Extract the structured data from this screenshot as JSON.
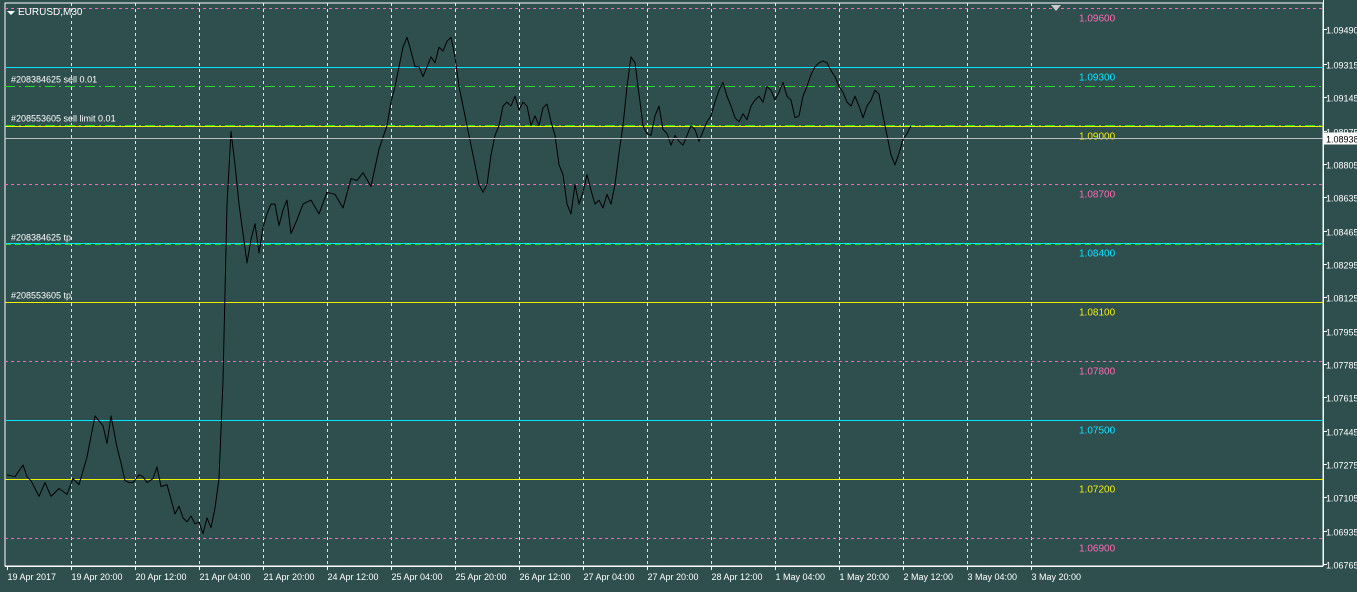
{
  "window": {
    "symbol_label": "EURUSD,M30"
  },
  "colors": {
    "background": "#2f4f4f",
    "frame": "#ffffff",
    "grid": "#ffffff",
    "price_line": "#000000",
    "magenta": "#ff69b4",
    "cyan": "#00e5ff",
    "yellow": "#f0f000",
    "lime": "#22dd22",
    "price_box": "#ffffff"
  },
  "chart_data": {
    "type": "line",
    "symbol": "EURUSD",
    "timeframe": "M30",
    "ylim": [
      1.06755,
      1.09625
    ],
    "y_ticks": [
      "1.09490",
      "1.09315",
      "1.09145",
      "1.08975",
      "1.08805",
      "1.08635",
      "1.08465",
      "1.08295",
      "1.08125",
      "1.07955",
      "1.07785",
      "1.07615",
      "1.07445",
      "1.07275",
      "1.07105",
      "1.06935",
      "1.06765"
    ],
    "y_tick_values": [
      1.0949,
      1.09315,
      1.09145,
      1.08975,
      1.08805,
      1.08635,
      1.08465,
      1.08295,
      1.08125,
      1.07955,
      1.07785,
      1.07615,
      1.07445,
      1.07275,
      1.07105,
      1.06935,
      1.06765
    ],
    "x_ticks": [
      "19 Apr 2017",
      "19 Apr 20:00",
      "20 Apr 12:00",
      "21 Apr 04:00",
      "21 Apr 20:00",
      "24 Apr 12:00",
      "25 Apr 04:00",
      "25 Apr 20:00",
      "26 Apr 12:00",
      "27 Apr 04:00",
      "27 Apr 20:00",
      "28 Apr 12:00",
      "1 May 04:00",
      "1 May 20:00",
      "2 May 12:00",
      "3 May 04:00",
      "3 May 20:00"
    ],
    "x_tick_index": [
      0,
      32,
      64,
      96,
      128,
      160,
      192,
      224,
      256,
      288,
      320,
      352,
      384,
      416,
      448,
      480,
      512
    ],
    "current_price": "1.08938",
    "current_price_value": 1.08938,
    "grid": true,
    "levels": [
      {
        "price": 1.096,
        "label": "1.09600",
        "color": "magenta",
        "style": "dash"
      },
      {
        "price": 1.093,
        "label": "1.09300",
        "color": "cyan",
        "style": "solid"
      },
      {
        "price": 1.09,
        "label": "1.09000",
        "color": "yellow",
        "style": "solid"
      },
      {
        "price": 1.087,
        "label": "1.08700",
        "color": "magenta",
        "style": "dash"
      },
      {
        "price": 1.084,
        "label": "1.08400",
        "color": "cyan",
        "style": "solid"
      },
      {
        "price": 1.081,
        "label": "1.08100",
        "color": "yellow",
        "style": "solid"
      },
      {
        "price": 1.078,
        "label": "1.07800",
        "color": "magenta",
        "style": "dash"
      },
      {
        "price": 1.075,
        "label": "1.07500",
        "color": "cyan",
        "style": "solid"
      },
      {
        "price": 1.072,
        "label": "1.07200",
        "color": "yellow",
        "style": "solid"
      },
      {
        "price": 1.069,
        "label": "1.06900",
        "color": "magenta",
        "style": "dash"
      }
    ],
    "orders": [
      {
        "price": 1.092,
        "label": "#208384625 sell 0.01",
        "color": "lime",
        "style": "dashdot"
      },
      {
        "price": 1.09005,
        "label": "#208553605 sell limit 0.01",
        "color": "lime",
        "style": "dashdot"
      },
      {
        "price": 1.08395,
        "label": "#208384625 tp",
        "color": "lime",
        "style": "dash"
      },
      {
        "price": 1.081,
        "label": "#208553605 tp",
        "color": "",
        "style": ""
      }
    ],
    "series": [
      {
        "x_index": [
          0,
          4,
          8,
          10,
          12,
          16,
          19,
          22,
          26,
          30,
          33,
          36,
          40,
          44,
          48,
          50,
          52,
          55,
          57,
          59,
          61,
          63,
          66,
          68,
          70,
          73,
          75,
          77,
          80,
          84,
          86,
          88,
          90,
          92,
          94,
          96,
          98,
          100,
          102,
          104,
          106,
          108,
          110,
          112,
          114,
          116,
          118,
          120,
          122,
          124,
          126,
          128,
          130,
          132,
          134,
          136,
          138,
          140,
          142,
          145,
          148,
          152,
          156,
          160,
          164,
          168,
          172,
          175,
          178,
          182,
          186,
          190,
          192,
          194,
          196,
          198,
          200,
          202,
          204,
          206,
          208,
          210,
          212,
          214,
          216,
          218,
          220,
          222,
          224,
          226,
          228,
          230,
          232,
          234,
          236,
          238,
          240,
          242,
          244,
          246,
          248,
          250,
          252,
          254,
          256,
          258,
          260,
          262,
          264,
          266,
          268,
          270,
          272,
          274,
          276,
          278,
          280,
          282,
          284,
          286,
          288,
          290,
          292,
          294,
          296,
          298,
          300,
          302,
          304,
          306,
          308,
          310,
          312,
          314,
          316,
          318,
          320,
          322,
          324,
          326,
          328,
          330,
          332,
          334,
          336,
          338,
          340,
          342,
          344,
          346,
          348,
          350,
          352,
          354,
          356,
          358,
          360,
          362,
          364,
          366,
          368,
          370,
          372,
          374,
          376,
          378,
          380,
          382,
          384,
          386,
          388,
          390,
          392,
          394,
          396,
          398,
          400,
          402,
          404,
          406,
          408,
          410,
          412,
          414,
          416,
          418,
          420,
          422,
          424,
          426,
          428,
          430,
          432,
          434,
          436,
          438,
          440,
          442,
          444,
          446,
          448,
          450,
          452,
          454,
          456,
          458,
          460,
          462,
          464,
          466,
          468,
          470,
          472,
          474,
          476,
          478,
          480,
          482,
          484,
          486,
          488,
          490,
          492,
          494,
          496,
          498,
          500,
          502,
          504,
          506,
          508,
          510,
          512,
          514,
          516,
          518,
          520,
          522,
          524
        ],
        "values": [
          1.0722,
          1.0721,
          1.0727,
          1.0721,
          1.0719,
          1.0711,
          1.0718,
          1.0711,
          1.0715,
          1.0712,
          1.072,
          1.0717,
          1.0731,
          1.0752,
          1.0747,
          1.0738,
          1.0752,
          1.0736,
          1.0728,
          1.0719,
          1.0718,
          1.0718,
          1.0722,
          1.0721,
          1.0718,
          1.072,
          1.0726,
          1.0716,
          1.0717,
          1.0702,
          1.0706,
          1.07,
          1.0698,
          1.0701,
          1.0697,
          1.0698,
          1.0692,
          1.07,
          1.0695,
          1.0705,
          1.072,
          1.077,
          1.086,
          1.0897,
          1.088,
          1.086,
          1.0845,
          1.083,
          1.0842,
          1.085,
          1.0835,
          1.0848,
          1.0855,
          1.086,
          1.086,
          1.0849,
          1.0857,
          1.0862,
          1.0845,
          1.0852,
          1.086,
          1.0862,
          1.0855,
          1.0866,
          1.0865,
          1.0858,
          1.0873,
          1.0872,
          1.0876,
          1.0869,
          1.0888,
          1.09,
          1.0912,
          1.092,
          1.093,
          1.094,
          1.0945,
          1.0938,
          1.093,
          1.093,
          1.0925,
          1.093,
          1.0935,
          1.0932,
          1.094,
          1.0938,
          1.0943,
          1.0945,
          1.0935,
          1.092,
          1.091,
          1.09,
          1.089,
          1.088,
          1.087,
          1.0866,
          1.087,
          1.0885,
          1.0895,
          1.09,
          1.091,
          1.0912,
          1.091,
          1.0915,
          1.0908,
          1.0912,
          1.091,
          1.09,
          1.0905,
          1.09,
          1.0909,
          1.0911,
          1.0902,
          1.0895,
          1.088,
          1.0875,
          1.086,
          1.0855,
          1.087,
          1.086,
          1.0866,
          1.0875,
          1.0867,
          1.086,
          1.0862,
          1.0858,
          1.0865,
          1.086,
          1.087,
          1.0886,
          1.09,
          1.092,
          1.0935,
          1.0932,
          1.0916,
          1.09,
          1.0896,
          1.0895,
          1.0905,
          1.091,
          1.0898,
          1.0896,
          1.089,
          1.0895,
          1.0892,
          1.089,
          1.0895,
          1.09,
          1.0898,
          1.0892,
          1.0897,
          1.0902,
          1.0905,
          1.0912,
          1.0918,
          1.0922,
          1.0915,
          1.091,
          1.0904,
          1.0902,
          1.0906,
          1.0903,
          1.091,
          1.0913,
          1.0915,
          1.0912,
          1.092,
          1.0918,
          1.0913,
          1.0917,
          1.0922,
          1.0915,
          1.0913,
          1.0904,
          1.0905,
          1.0915,
          1.092,
          1.0926,
          1.093,
          1.0932,
          1.0933,
          1.0932,
          1.0928,
          1.0925,
          1.092,
          1.0917,
          1.0912,
          1.091,
          1.0915,
          1.091,
          1.0904,
          1.091,
          1.0913,
          1.0918,
          1.0916,
          1.0905,
          1.0895,
          1.0885,
          1.088,
          1.0886,
          1.0893,
          1.0896,
          1.09
        ]
      }
    ]
  }
}
